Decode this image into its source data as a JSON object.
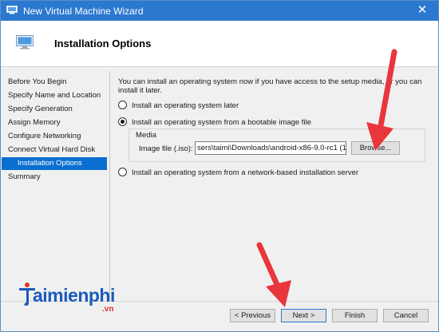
{
  "window": {
    "title": "New Virtual Machine Wizard",
    "close_glyph": "✕"
  },
  "header": {
    "title": "Installation Options"
  },
  "sidebar": {
    "items": [
      {
        "label": "Before You Begin"
      },
      {
        "label": "Specify Name and Location"
      },
      {
        "label": "Specify Generation"
      },
      {
        "label": "Assign Memory"
      },
      {
        "label": "Configure Networking"
      },
      {
        "label": "Connect Virtual Hard Disk"
      },
      {
        "label": "Installation Options"
      },
      {
        "label": "Summary"
      }
    ],
    "active_index": 6
  },
  "main": {
    "intro": "You can install an operating system now if you have access to the setup media, or you can install it later.",
    "options": [
      {
        "label": "Install an operating system later",
        "selected": false
      },
      {
        "label": "Install an operating system from a bootable image file",
        "selected": true
      },
      {
        "label": "Install an operating system from a network-based installation server",
        "selected": false
      }
    ],
    "media": {
      "group_label": "Media",
      "image_file_label": "Image file (.iso):",
      "image_file_value": "sers\\taimi\\Downloads\\android-x86-9.0-rc1 (1).iso",
      "browse_label": "Browse..."
    }
  },
  "footer": {
    "previous_label": "< Previous",
    "next_label": "Next >",
    "finish_label": "Finish",
    "cancel_label": "Cancel"
  },
  "watermark": {
    "brand": "aimienphi",
    "brand_initial": "T",
    "suffix": ".vn"
  },
  "colors": {
    "titlebar": "#2b78d0",
    "selection": "#0a6fd0",
    "annotation_arrow": "#e8363c",
    "brand_blue": "#1a5bbd"
  }
}
